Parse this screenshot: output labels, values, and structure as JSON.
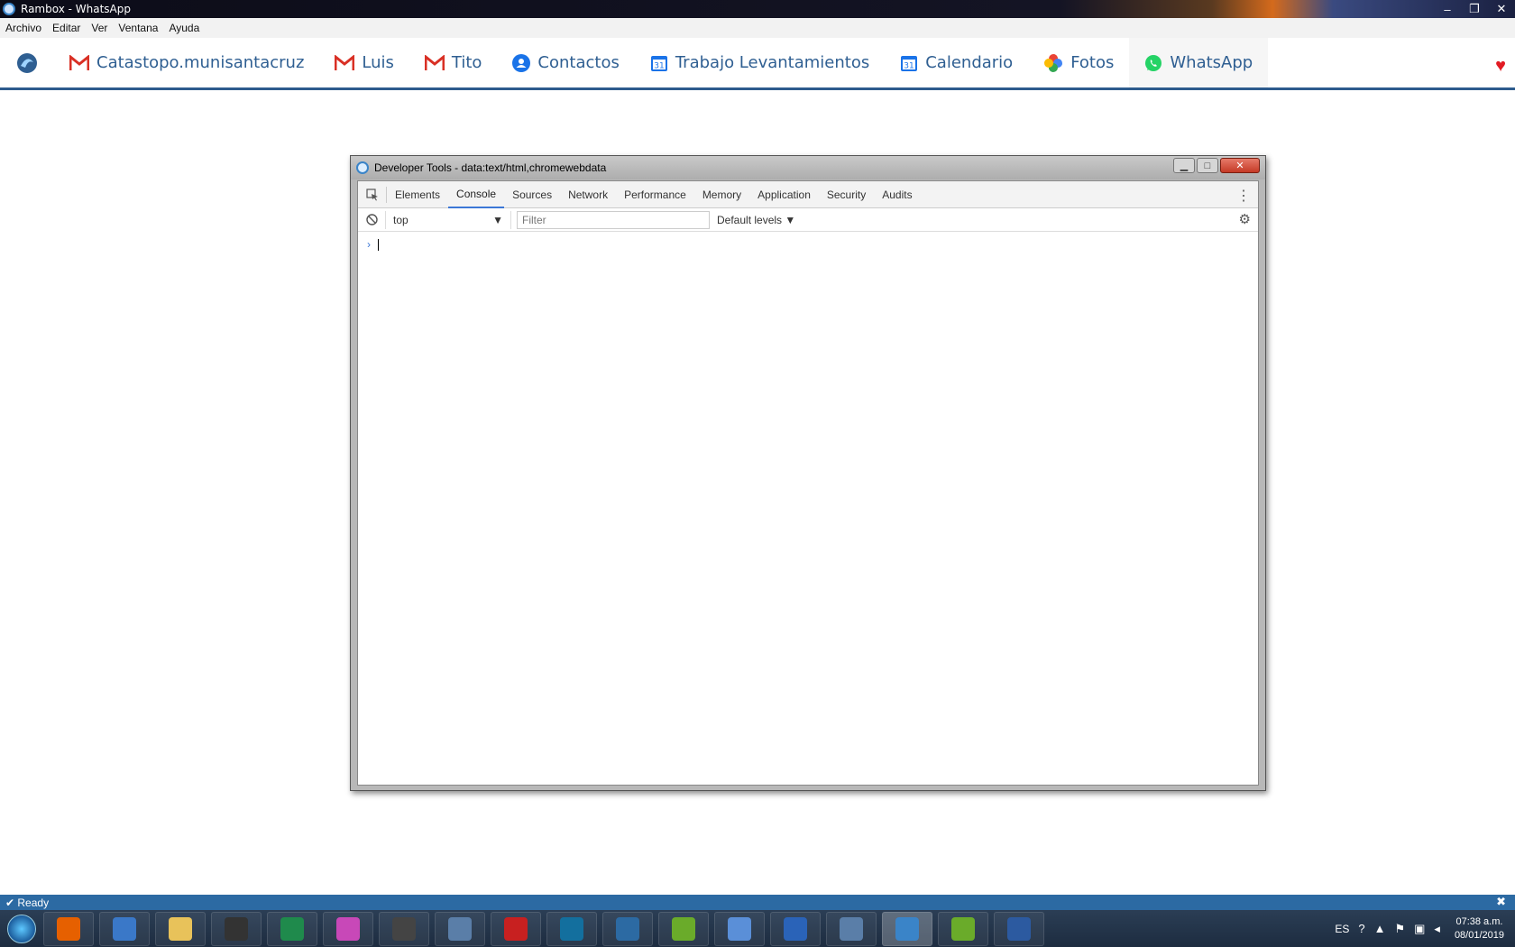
{
  "window": {
    "title": "Rambox - WhatsApp",
    "controls": [
      "–",
      "❐",
      "✕"
    ]
  },
  "menu": [
    "Archivo",
    "Editar",
    "Ver",
    "Ventana",
    "Ayuda"
  ],
  "tabs": [
    {
      "label": "Catastopo.munisantacruz",
      "icon": "gmail-icon"
    },
    {
      "label": "Luis",
      "icon": "gmail-icon"
    },
    {
      "label": "Tito",
      "icon": "gmail-icon"
    },
    {
      "label": "Contactos",
      "icon": "contacts-icon"
    },
    {
      "label": "Trabajo Levantamientos",
      "icon": "calendar-icon"
    },
    {
      "label": "Calendario",
      "icon": "calendar-icon"
    },
    {
      "label": "Fotos",
      "icon": "photos-icon"
    },
    {
      "label": "WhatsApp",
      "icon": "whatsapp-icon",
      "active": true
    }
  ],
  "devtools": {
    "title": "Developer Tools - data:text/html,chromewebdata",
    "tabs": [
      "Elements",
      "Console",
      "Sources",
      "Network",
      "Performance",
      "Memory",
      "Application",
      "Security",
      "Audits"
    ],
    "active_tab": "Console",
    "context": "top",
    "filter_placeholder": "Filter",
    "levels": "Default levels",
    "prompt": "›"
  },
  "status": {
    "text": "Ready"
  },
  "taskbar": {
    "apps": [
      {
        "name": "firefox",
        "color": "#e66000"
      },
      {
        "name": "app-a",
        "color": "#3a78c8"
      },
      {
        "name": "file-explorer",
        "color": "#e8c25a"
      },
      {
        "name": "obs",
        "color": "#333333"
      },
      {
        "name": "sheets",
        "color": "#1f8a4c"
      },
      {
        "name": "color-app",
        "color": "#c848b8"
      },
      {
        "name": "inkscape",
        "color": "#444444"
      },
      {
        "name": "calculator",
        "color": "#5a7ea8"
      },
      {
        "name": "red-app",
        "color": "#c82020"
      },
      {
        "name": "panel-app",
        "color": "#136f9e"
      },
      {
        "name": "dtc-app",
        "color": "#2c6aa3"
      },
      {
        "name": "qgis-a",
        "color": "#6aab2a"
      },
      {
        "name": "mail-app",
        "color": "#5a8fd8"
      },
      {
        "name": "writer",
        "color": "#2a63b8"
      },
      {
        "name": "drawing-app",
        "color": "#5a7ea8"
      },
      {
        "name": "rambox",
        "color": "#3a84c8",
        "active": true
      },
      {
        "name": "qgis-b",
        "color": "#6aab2a"
      },
      {
        "name": "v-app",
        "color": "#2c5aa0"
      }
    ],
    "tray": {
      "lang": "ES",
      "time": "07:38 a.m.",
      "date": "08/01/2019"
    }
  }
}
